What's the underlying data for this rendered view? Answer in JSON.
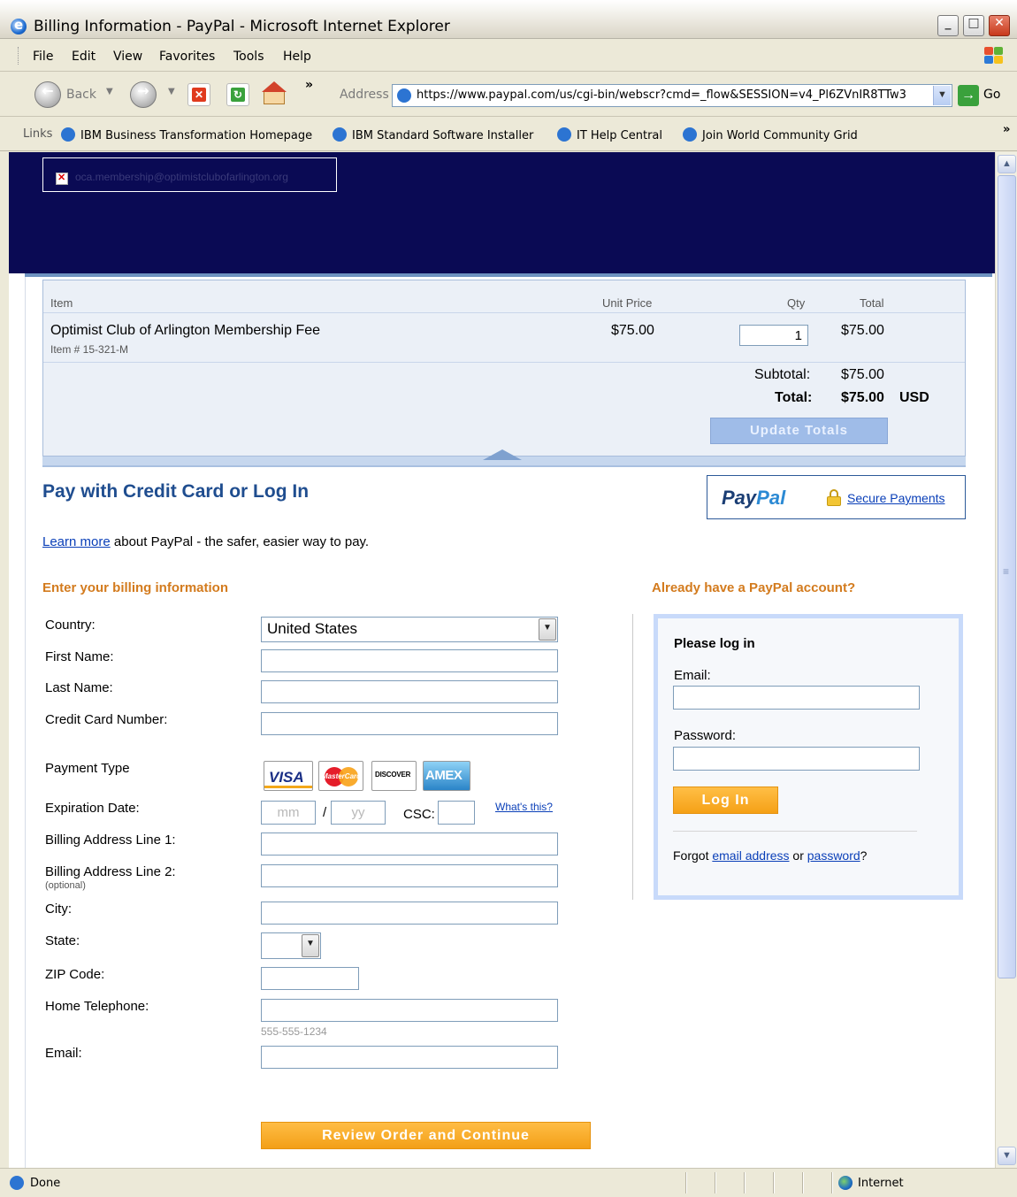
{
  "window": {
    "title": "Billing Information - PayPal - Microsoft Internet Explorer",
    "min_glyph": "_",
    "max_glyph": "□",
    "close_glyph": "✕"
  },
  "menu": [
    "File",
    "Edit",
    "View",
    "Favorites",
    "Tools",
    "Help"
  ],
  "toolbar": {
    "back_label": "Back",
    "chevron": "»",
    "address_label": "Address",
    "url": "https://www.paypal.com/us/cgi-bin/webscr?cmd=_flow&SESSION=v4_Pl6ZVnIR8TTw3",
    "go_label": "Go"
  },
  "links": {
    "label": "Links",
    "items": [
      "IBM Business Transformation Homepage",
      "IBM Standard Software Installer",
      "IT Help Central",
      "Join World Community Grid"
    ],
    "more": "»"
  },
  "header": {
    "logo_alt": "oca.membership@optimistclubofarlington.org"
  },
  "cart": {
    "columns": {
      "item": "Item",
      "unit_price": "Unit Price",
      "qty": "Qty",
      "total": "Total"
    },
    "item_name": "Optimist Club of Arlington Membership Fee",
    "item_number": "Item # 15-321-M",
    "unit_price": "$75.00",
    "qty": "1",
    "line_total": "$75.00",
    "subtotal_label": "Subtotal:",
    "subtotal": "$75.00",
    "total_label": "Total:",
    "total": "$75.00",
    "currency": "USD",
    "update_button": "Update Totals"
  },
  "payment": {
    "title": "Pay with Credit Card or Log In",
    "learn_more_link": "Learn more",
    "learn_more_rest": " about PayPal - the safer, easier way to pay.",
    "paypal_logo_a": "Pay",
    "paypal_logo_b": "Pal",
    "secure_link": "Secure Payments"
  },
  "billing": {
    "heading": "Enter your billing information",
    "country_label": "Country:",
    "country_value": "United States",
    "first_name_label": "First Name:",
    "last_name_label": "Last Name:",
    "cc_label": "Credit Card Number:",
    "payment_type_label": "Payment Type",
    "cards": {
      "visa": "VISA",
      "mastercard": "MasterCard",
      "discover": "DISCOVER",
      "amex": "AMEX"
    },
    "exp_label": "Expiration Date:",
    "exp_month_placeholder": "mm",
    "exp_slash": "/",
    "exp_year_placeholder": "yy",
    "csc_label": "CSC:",
    "whats_this": "What's this?",
    "addr1_label": "Billing Address Line 1:",
    "addr2_label": "Billing Address Line 2:",
    "addr2_note": "(optional)",
    "city_label": "City:",
    "state_label": "State:",
    "zip_label": "ZIP Code:",
    "phone_label": "Home Telephone:",
    "phone_hint": "555-555-1234",
    "email_label": "Email:",
    "review_button": "Review Order and Continue"
  },
  "login": {
    "heading": "Already have a PayPal account?",
    "box_title": "Please log in",
    "email_label": "Email:",
    "password_label": "Password:",
    "login_button": "Log In",
    "forgot_prefix": "Forgot ",
    "forgot_email": "email address",
    "forgot_or": " or ",
    "forgot_password": "password",
    "forgot_suffix": "?"
  },
  "status": {
    "text": "Done",
    "zone": "Internet"
  },
  "colors": {
    "header_navy": "#0a0a54",
    "title_blue": "#1f4d8f",
    "section_orange": "#d37b1e",
    "button_orange": "#f5a016",
    "link_blue": "#0a3fb8"
  }
}
